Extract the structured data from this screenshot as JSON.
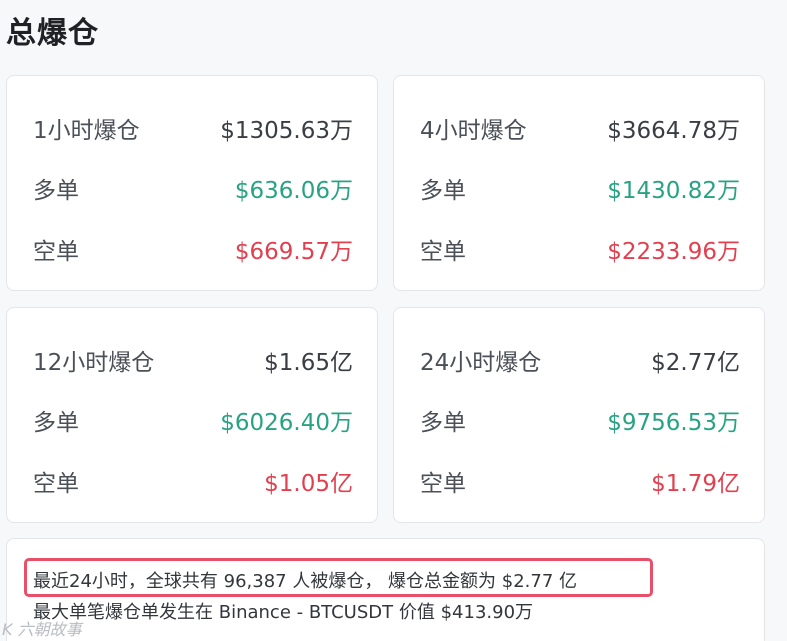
{
  "page": {
    "title": "总爆仓"
  },
  "cards": [
    {
      "period": "1小时爆仓",
      "total": "$1305.63万",
      "long_label": "多单",
      "long_value": "$636.06万",
      "short_label": "空单",
      "short_value": "$669.57万"
    },
    {
      "period": "4小时爆仓",
      "total": "$3664.78万",
      "long_label": "多单",
      "long_value": "$1430.82万",
      "short_label": "空单",
      "short_value": "$2233.96万"
    },
    {
      "period": "12小时爆仓",
      "total": "$1.65亿",
      "long_label": "多单",
      "long_value": "$6026.40万",
      "short_label": "空单",
      "short_value": "$1.05亿"
    },
    {
      "period": "24小时爆仓",
      "total": "$2.77亿",
      "long_label": "多单",
      "long_value": "$9756.53万",
      "short_label": "空单",
      "short_value": "$1.79亿"
    }
  ],
  "summary": {
    "line1": "最近24小时，全球共有 96,387 人被爆仓， 爆仓总金额为 $2.77 亿",
    "line2": "最大单笔爆仓单发生在 Binance - BTCUSDT 价值 $413.90万"
  },
  "watermark": "K 六朝故事",
  "colors": {
    "long": "#27a383",
    "short": "#e0404f",
    "highlight": "#e8506a"
  }
}
